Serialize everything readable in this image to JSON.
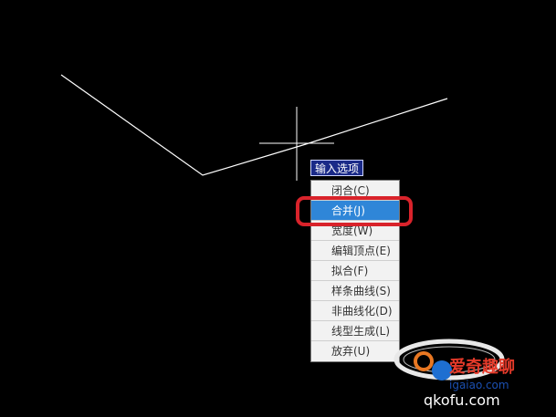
{
  "prompt": {
    "label": "输入选项"
  },
  "menu": {
    "items": [
      {
        "label": "闭合(C)",
        "selected": false
      },
      {
        "label": "合并(J)",
        "selected": true
      },
      {
        "label": "宽度(W)",
        "selected": false
      },
      {
        "label": "编辑顶点(E)",
        "selected": false
      },
      {
        "label": "拟合(F)",
        "selected": false
      },
      {
        "label": "样条曲线(S)",
        "selected": false
      },
      {
        "label": "非曲线化(D)",
        "selected": false
      },
      {
        "label": "线型生成(L)",
        "selected": false
      },
      {
        "label": "放弃(U)",
        "selected": false
      }
    ]
  },
  "watermark": {
    "text_main": "爱奇趣聊",
    "text_url1": "igaiao.com",
    "text_url2": "qkofu.com"
  },
  "colors": {
    "background": "#000000",
    "line": "#ffffff",
    "selection": "#2f86d8",
    "highlight": "#d9232b",
    "prompt_bg": "#1a2a88"
  }
}
